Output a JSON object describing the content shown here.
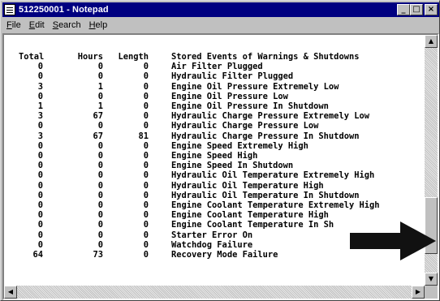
{
  "window": {
    "title": "512250001 - Notepad",
    "controls": {
      "minimize": "_",
      "maximize": "□",
      "close": "×"
    }
  },
  "menu": {
    "items": [
      {
        "label_ul": "F",
        "label_rest": "ile"
      },
      {
        "label_ul": "E",
        "label_rest": "dit"
      },
      {
        "label_ul": "S",
        "label_rest": "earch"
      },
      {
        "label_ul": "H",
        "label_rest": "elp"
      }
    ]
  },
  "table": {
    "headers": {
      "total": "Total",
      "hours": "Hours",
      "length": "Length",
      "desc": "Stored Events of Warnings & Shutdowns"
    },
    "rows": [
      {
        "total": "0",
        "hours": "0",
        "length": "0",
        "desc": "Air Filter Plugged"
      },
      {
        "total": "0",
        "hours": "0",
        "length": "0",
        "desc": "Hydraulic Filter Plugged"
      },
      {
        "total": "3",
        "hours": "1",
        "length": "0",
        "desc": "Engine Oil Pressure Extremely Low"
      },
      {
        "total": "0",
        "hours": "0",
        "length": "0",
        "desc": "Engine Oil Pressure Low"
      },
      {
        "total": "1",
        "hours": "1",
        "length": "0",
        "desc": "Engine Oil Pressure In Shutdown"
      },
      {
        "total": "3",
        "hours": "67",
        "length": "0",
        "desc": "Hydraulic Charge Pressure Extremely Low"
      },
      {
        "total": "0",
        "hours": "0",
        "length": "0",
        "desc": "Hydraulic Charge Pressure Low"
      },
      {
        "total": "3",
        "hours": "67",
        "length": "81",
        "desc": "Hydraulic Charge Pressure In Shutdown"
      },
      {
        "total": "0",
        "hours": "0",
        "length": "0",
        "desc": "Engine Speed Extremely High"
      },
      {
        "total": "0",
        "hours": "0",
        "length": "0",
        "desc": "Engine Speed High"
      },
      {
        "total": "0",
        "hours": "0",
        "length": "0",
        "desc": "Engine Speed In Shutdown"
      },
      {
        "total": "0",
        "hours": "0",
        "length": "0",
        "desc": "Hydraulic Oil Temperature Extremely High"
      },
      {
        "total": "0",
        "hours": "0",
        "length": "0",
        "desc": "Hydraulic Oil Temperature High"
      },
      {
        "total": "0",
        "hours": "0",
        "length": "0",
        "desc": "Hydraulic Oil Temperature In Shutdown"
      },
      {
        "total": "0",
        "hours": "0",
        "length": "0",
        "desc": "Engine Coolant Temperature Extremely High"
      },
      {
        "total": "0",
        "hours": "0",
        "length": "0",
        "desc": "Engine Coolant Temperature High"
      },
      {
        "total": "0",
        "hours": "0",
        "length": "0",
        "desc": "Engine Coolant Temperature In Sh"
      },
      {
        "total": "0",
        "hours": "0",
        "length": "0",
        "desc": "Starter Error On"
      },
      {
        "total": "0",
        "hours": "0",
        "length": "0",
        "desc": "Watchdog Failure"
      },
      {
        "total": "64",
        "hours": "73",
        "length": "0",
        "desc": "Recovery Mode Failure"
      }
    ]
  },
  "scrollbars": {
    "up": "▲",
    "down": "▼",
    "left": "◀",
    "right": "▶"
  },
  "colors": {
    "titlebar": "#000080",
    "arrow": "#111111"
  }
}
